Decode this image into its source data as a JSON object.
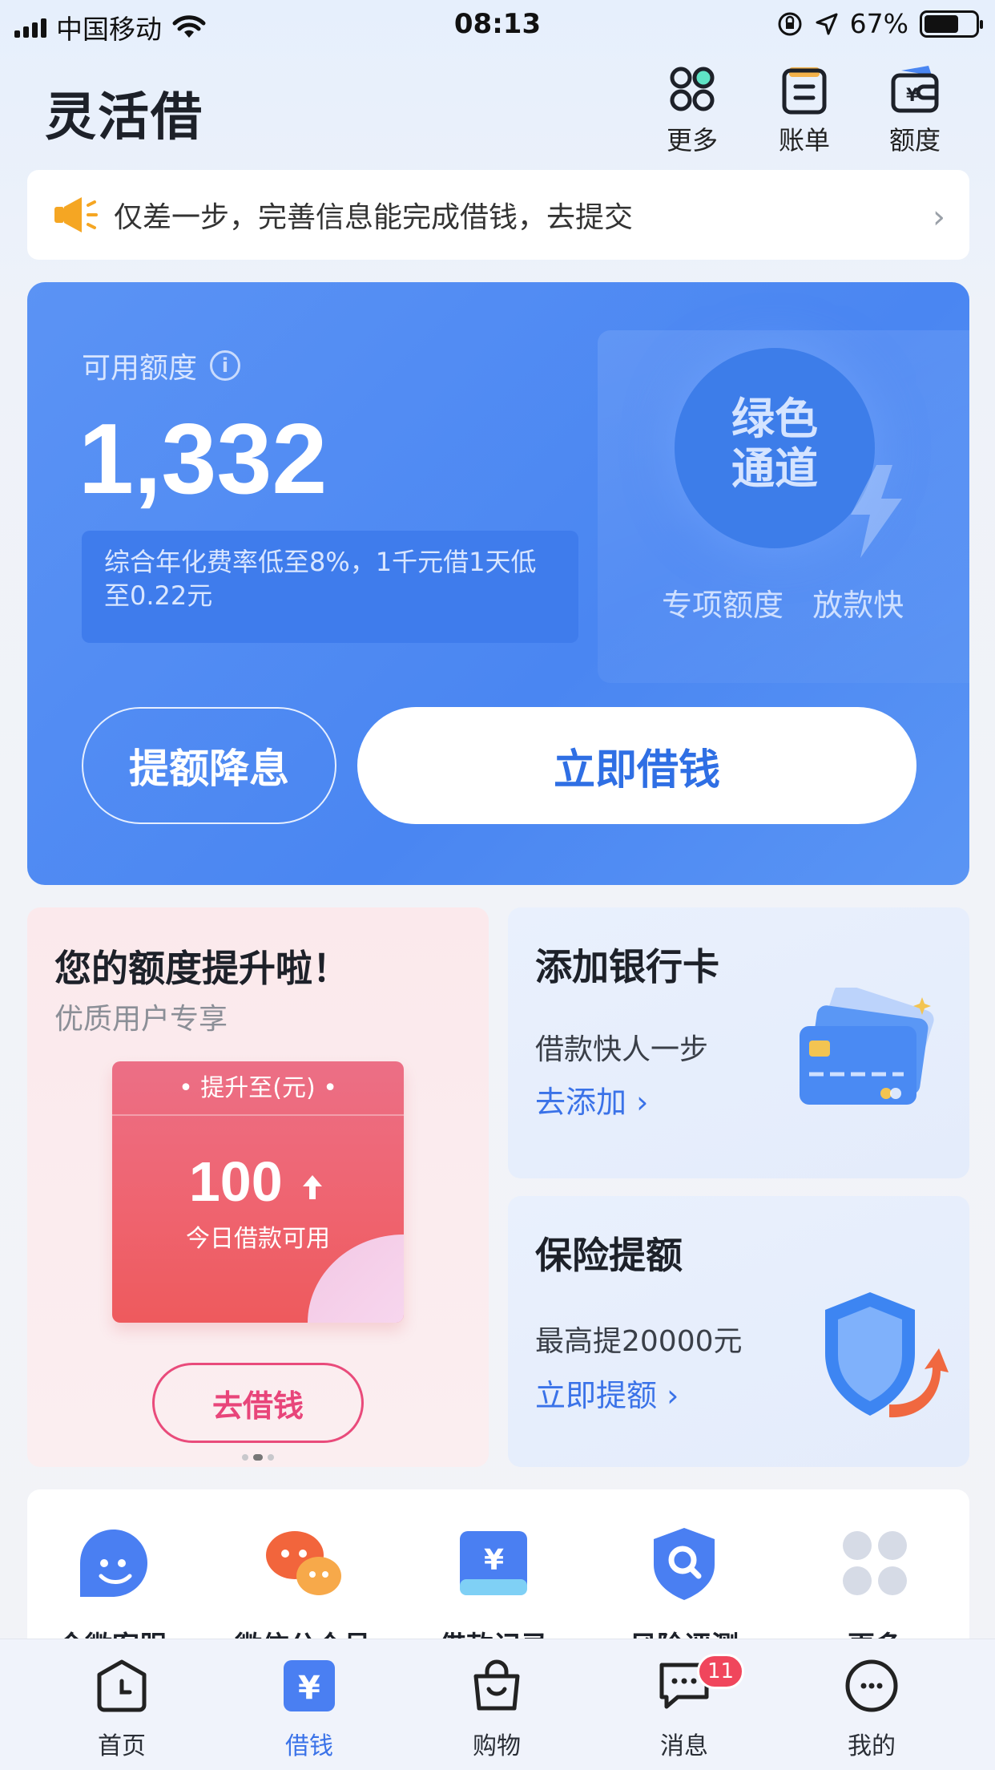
{
  "status_bar": {
    "carrier": "中国移动",
    "time": "08:13",
    "battery": "67%",
    "battery_level": 0.67
  },
  "header": {
    "title": "灵活借",
    "actions": [
      {
        "label": "更多",
        "icon": "grid-icon"
      },
      {
        "label": "账单",
        "icon": "bill-icon"
      },
      {
        "label": "额度",
        "icon": "wallet-icon"
      }
    ]
  },
  "notice": {
    "text": "仅差一步，完善信息能完成借钱，去提交",
    "icon": "megaphone-icon"
  },
  "credit": {
    "label": "可用额度",
    "amount": "1,332",
    "rate_text": "综合年化费率低至8%，1千元借1天低至0.22元",
    "green_channel_title_line1": "绿色",
    "green_channel_title_line2": "通道",
    "green_channel_sub": "专项额度   放款快",
    "raise_button": "提额降息",
    "borrow_button": "立即借钱"
  },
  "promo": {
    "title": "您的额度提升啦！",
    "subtitle": "优质用户专享",
    "ticket_header": "• 提升至(元) •",
    "ticket_amount": "100",
    "ticket_caption": "今日借款可用",
    "button": "去借钱",
    "page_count": 3,
    "active_page": 1
  },
  "bank_card": {
    "title": "添加银行卡",
    "desc": "借款快人一步",
    "link": "去添加 ›"
  },
  "insurance": {
    "title": "保险提额",
    "desc": "最高提20000元",
    "link": "立即提额 ›"
  },
  "services": [
    {
      "label": "企微客服",
      "icon": "customer-service-icon"
    },
    {
      "label": "微信公众号",
      "icon": "wechat-icon"
    },
    {
      "label": "借款记录",
      "icon": "loan-record-icon"
    },
    {
      "label": "风险评测",
      "icon": "risk-assessment-icon"
    },
    {
      "label": "更多",
      "icon": "more-grid-icon"
    }
  ],
  "tabbar": {
    "tabs": [
      {
        "label": "首页",
        "icon": "home-clock-icon",
        "active": false
      },
      {
        "label": "借钱",
        "icon": "yuan-icon",
        "active": true
      },
      {
        "label": "购物",
        "icon": "shopping-bag-icon",
        "active": false
      },
      {
        "label": "消息",
        "icon": "message-icon",
        "active": false,
        "badge": "11"
      },
      {
        "label": "我的",
        "icon": "profile-icon",
        "active": false
      }
    ]
  },
  "colors": {
    "primary": "#4a86f2",
    "accent_pink": "#e94b7b",
    "link_blue": "#3a72e8",
    "badge_red": "#f0465c"
  }
}
